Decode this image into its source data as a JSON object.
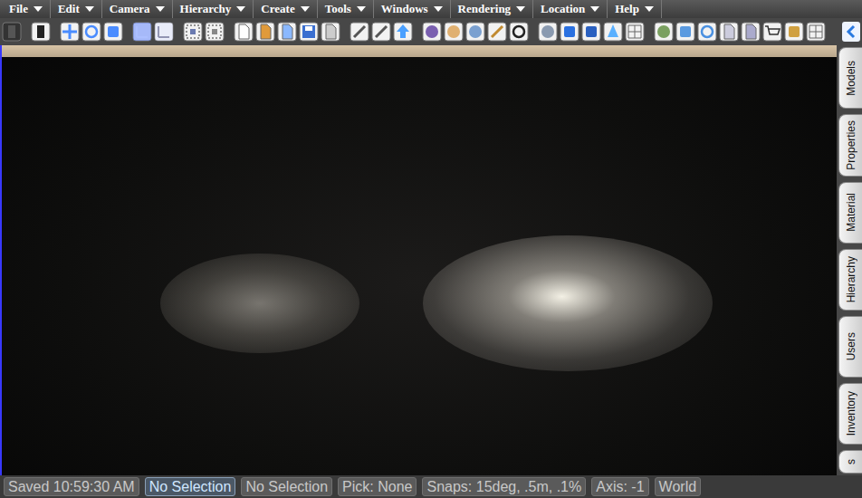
{
  "menu": [
    {
      "label": "File"
    },
    {
      "label": "Edit"
    },
    {
      "label": "Camera"
    },
    {
      "label": "Hierarchy"
    },
    {
      "label": "Create"
    },
    {
      "label": "Tools"
    },
    {
      "label": "Windows"
    },
    {
      "label": "Rendering"
    },
    {
      "label": "Location"
    },
    {
      "label": "Help"
    }
  ],
  "side_tabs": [
    {
      "label": "Models",
      "selected": false
    },
    {
      "label": "Properties",
      "selected": false
    },
    {
      "label": "Material",
      "selected": false
    },
    {
      "label": "Hierarchy",
      "selected": false
    },
    {
      "label": "Users",
      "selected": false
    },
    {
      "label": "Inventory",
      "selected": false
    },
    {
      "label": "s",
      "selected": false
    }
  ],
  "status_bar": [
    {
      "text": "Saved 10:59:30 AM",
      "highlighted": false
    },
    {
      "text": "No Selection",
      "highlighted": true
    },
    {
      "text": "No Selection",
      "highlighted": false
    },
    {
      "text": "Pick: None",
      "highlighted": false
    },
    {
      "text": "Snaps: 15deg, .5m, .1%",
      "highlighted": false
    },
    {
      "text": "Axis: -1",
      "highlighted": false
    },
    {
      "text": "World",
      "highlighted": false
    }
  ]
}
